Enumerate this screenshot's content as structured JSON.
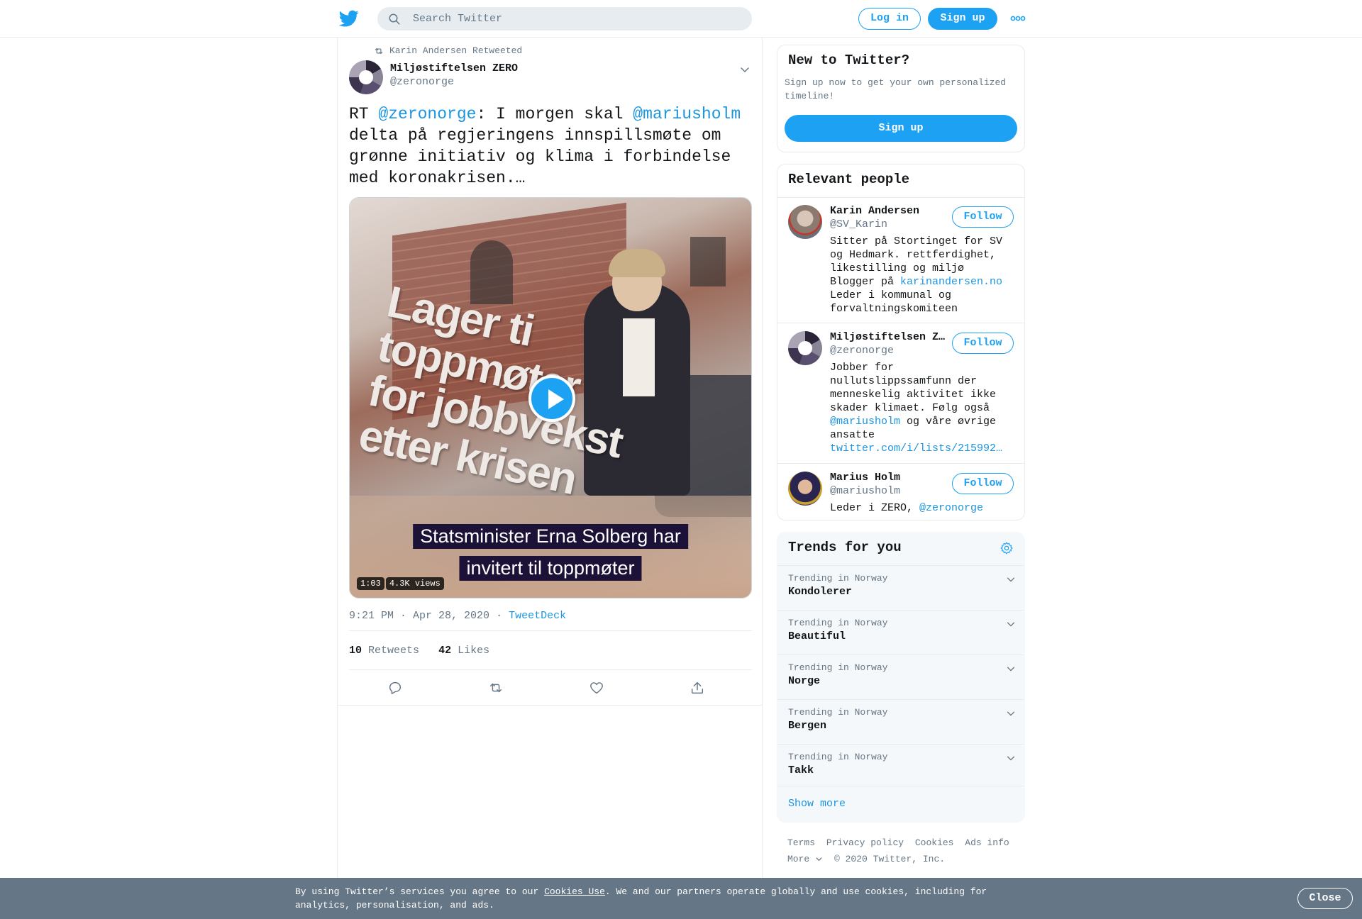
{
  "header": {
    "search_placeholder": "Search Twitter",
    "login_label": "Log in",
    "signup_label": "Sign up"
  },
  "tweet": {
    "retweeted_by": "Karin Andersen Retweeted",
    "author_name": "Miljøstiftelsen ZERO",
    "author_handle": "@zeronorge",
    "text_prefix": "RT ",
    "mention1": "@zeronorge",
    "text_mid": ": I morgen skal ",
    "mention2": "@mariusholm",
    "text_rest": " delta på regjeringens innspillsmøte om grønne initiativ og klima i forbindelse med koronakrisen.…",
    "video": {
      "overlay_text_line1": "Lager ti",
      "overlay_text_line2": "toppmøter",
      "overlay_text_line3": "for jobbvekst",
      "overlay_text_line4": "etter krisen",
      "caption_line1": "Statsminister Erna Solberg har",
      "caption_line2": "invitert til toppmøter",
      "duration": "1:03",
      "views": "4.3K views"
    },
    "timestamp": "9:21 PM · Apr 28, 2020",
    "source_separator": "·",
    "source": "TweetDeck",
    "retweets_count": "10",
    "retweets_label": "Retweets",
    "likes_count": "42",
    "likes_label": "Likes"
  },
  "sidebar": {
    "new_to_twitter": {
      "title": "New to Twitter?",
      "description": "Sign up now to get your own personalized timeline!",
      "button_label": "Sign up"
    },
    "relevant_people": {
      "title": "Relevant people",
      "follow_label": "Follow",
      "people": [
        {
          "name": "Karin Andersen",
          "handle": "@SV_Karin",
          "bio_part1": "Sitter på Stortinget for SV og Hedmark. rettferdighet, likestilling og miljø Blogger på ",
          "bio_link": "karinandersen.no",
          "bio_part2": " Leder i kommunal og forvaltningskomiteen"
        },
        {
          "name": "Miljøstiftelsen ZERO",
          "handle": "@zeronorge",
          "bio_part1": "Jobber for nullutslippssamfunn der menneskelig aktivitet ikke skader klimaet. Følg også ",
          "bio_link": "@mariusholm",
          "bio_part2": " og våre øvrige ansatte ",
          "bio_link2": "twitter.com/i/lists/215992…"
        },
        {
          "name": "Marius Holm",
          "handle": "@mariusholm",
          "bio_part1": "Leder i ZERO, ",
          "bio_link": "@zeronorge"
        }
      ]
    },
    "trends": {
      "title": "Trends for you",
      "items": [
        {
          "context": "Trending in Norway",
          "name": "Kondolerer"
        },
        {
          "context": "Trending in Norway",
          "name": "Beautiful"
        },
        {
          "context": "Trending in Norway",
          "name": "Norge"
        },
        {
          "context": "Trending in Norway",
          "name": "Bergen"
        },
        {
          "context": "Trending in Norway",
          "name": "Takk"
        }
      ],
      "show_more": "Show more"
    },
    "footer": {
      "links": [
        "Terms",
        "Privacy policy",
        "Cookies",
        "Ads info"
      ],
      "more": "More",
      "copyright": "© 2020 Twitter, Inc."
    }
  },
  "cookie_banner": {
    "text_before": "By using Twitter’s services you agree to our ",
    "link": "Cookies Use",
    "text_after": ". We and our partners operate globally and use cookies, including for analytics, personalisation, and ads.",
    "close_label": "Close"
  },
  "colors": {
    "accent": "#1da1f2",
    "link": "#1b95e0",
    "muted": "#657786",
    "cookie_bar": "#657786"
  }
}
